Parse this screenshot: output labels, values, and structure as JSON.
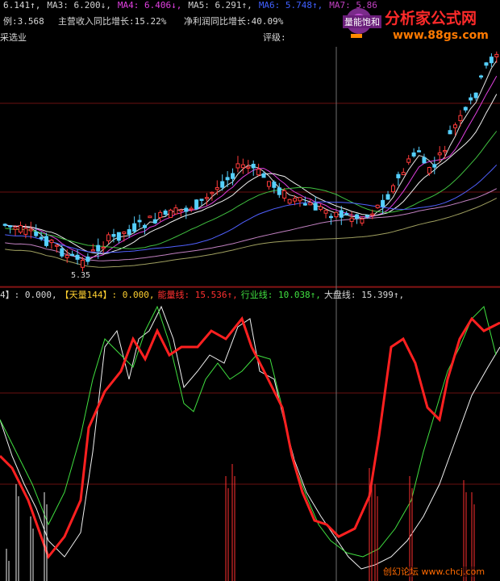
{
  "header": {
    "row1": [
      {
        "text": "6.141↑,",
        "color": "#d8d8d8"
      },
      {
        "text": "MA3: 6.200↓,",
        "color": "#d0d0d0"
      },
      {
        "text": "MA4: 6.406↓,",
        "color": "#e040e0"
      },
      {
        "text": "MA5: 6.291↑,",
        "color": "#d0d0d0"
      },
      {
        "text": "MA6: 5.748↑,",
        "color": "#4060ff"
      },
      {
        "text": "MA7: 5.86",
        "color": "#c040c0"
      }
    ],
    "row2": [
      {
        "text": "例:3.568",
        "color": "#d8d8d8"
      },
      {
        "text": "主营收入同比增长:15.22%",
        "color": "#d8d8d8"
      },
      {
        "text": "净利润同比增长:40.09%",
        "color": "#d8d8d8"
      }
    ],
    "row3": [
      {
        "text": "采选业",
        "color": "#d8d8d8"
      },
      {
        "text": "评级:",
        "color": "#d8d8d8"
      }
    ],
    "low_label": "5.35"
  },
  "indicator_header": [
    {
      "text": "4】: 0.000,",
      "color": "#d8d8d8"
    },
    {
      "text": "【天量144】: 0.000,",
      "color": "#ffd030"
    },
    {
      "text": "能量线: 15.536↑,",
      "color": "#ff3030"
    },
    {
      "text": "行业线: 10.038↑,",
      "color": "#40e040"
    },
    {
      "text": "大盘线: 15.399↑,",
      "color": "#d8d8d8"
    }
  ],
  "watermarks": {
    "brand": "分析家公式网",
    "url": "www.88gs.com",
    "badge": "量能饱和",
    "bottom": "创幻论坛 www.chcj.com"
  },
  "chart_data": [
    {
      "type": "candlestick",
      "title": "",
      "candle_count": 96,
      "price_low_marked": 5.35,
      "ma_series": [
        {
          "name": "MA3",
          "last": 6.2,
          "color": "#d0d0d0"
        },
        {
          "name": "MA4",
          "last": 6.406,
          "color": "#e040e0"
        },
        {
          "name": "MA5",
          "last": 6.291,
          "color": "#d0d0d0"
        },
        {
          "name": "MA6",
          "last": 5.748,
          "color": "#4060ff"
        }
      ],
      "grid": true
    },
    {
      "type": "line",
      "title": "",
      "series": [
        {
          "name": "能量线",
          "last": 15.536,
          "color": "#ff3030"
        },
        {
          "name": "行业线",
          "last": 10.038,
          "color": "#40e040"
        },
        {
          "name": "大盘线",
          "last": 15.399,
          "color": "#d8d8d8"
        }
      ],
      "grid": true
    }
  ]
}
